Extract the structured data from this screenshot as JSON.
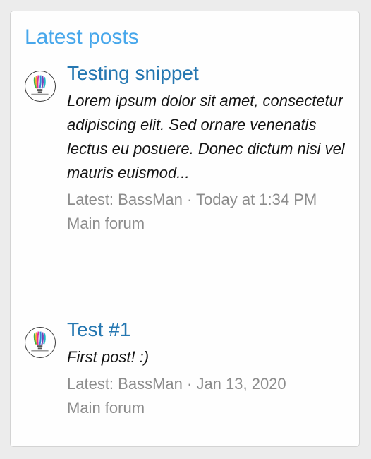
{
  "widget": {
    "title": "Latest posts"
  },
  "posts": [
    {
      "title": "Testing snippet",
      "snippet": "Lorem ipsum dolor sit amet, consectetur adipiscing elit. Sed ornare venenatis lectus eu posuere. Donec dictum nisi vel mauris euismod...",
      "latest_prefix": "Latest: ",
      "author": "BassMan",
      "separator": " · ",
      "time": "Today at 1:34 PM",
      "forum": "Main forum",
      "avatar_icon": "lightbulb-logo-icon"
    },
    {
      "title": "Test #1",
      "snippet": "First post! :)",
      "latest_prefix": "Latest: ",
      "author": "BassMan",
      "separator": " · ",
      "time": "Jan 13, 2020",
      "forum": "Main forum",
      "avatar_icon": "lightbulb-logo-icon"
    }
  ]
}
